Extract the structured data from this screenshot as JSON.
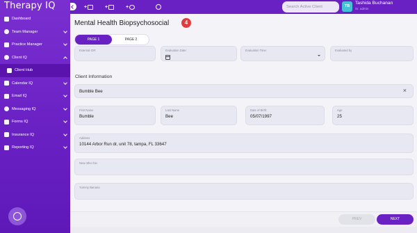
{
  "app": {
    "name": "Therapy IQ"
  },
  "sidebar": {
    "items": [
      {
        "label": "Dashboard",
        "icon": "grid-icon"
      },
      {
        "label": "Team Manager",
        "icon": "team-icon"
      },
      {
        "label": "Practice Manager",
        "icon": "briefcase-icon"
      },
      {
        "label": "Client IQ",
        "icon": "people-icon"
      },
      {
        "label": "Client Hub",
        "icon": "hub-icon"
      },
      {
        "label": "Calendar IQ",
        "icon": "calendar-icon"
      },
      {
        "label": "Email IQ",
        "icon": "email-icon"
      },
      {
        "label": "Messaging IQ",
        "icon": "chat-icon"
      },
      {
        "label": "Forms IQ",
        "icon": "forms-icon"
      },
      {
        "label": "Insurance IQ",
        "icon": "insurance-icon"
      },
      {
        "label": "Reporting IQ",
        "icon": "reporting-icon"
      }
    ]
  },
  "topbar": {
    "search_placeholder": "Search Active Client",
    "user_initials": "TB",
    "user_name": "Tashida Buchanan",
    "user_role": "Sr. admin"
  },
  "page": {
    "title": "Mental Health Biopsychosocial",
    "step_badge": "4",
    "tabs": [
      "PAGE 1",
      "PAGE 2"
    ]
  },
  "form": {
    "external_id_label": "External ID#:",
    "eval_date_label": "Evaluation Date:",
    "eval_time_label": "Evaluation Time:",
    "evaluated_by_label": "Evaluated by",
    "section_title": "Client Information",
    "client_select": "Bumble Bee",
    "first_name_label": "First Name",
    "first_name": "Bumble",
    "last_name_label": "Last Name",
    "last_name": "Bee",
    "dob_label": "Date of Birth:",
    "dob": "05/07/1997",
    "age_label": "Age",
    "age": "25",
    "address_label": "Address",
    "address": "10144 Arbor Run dr, unit 78, tampa, FL 33647",
    "other_bio_label": "New other bio",
    "yummy_label": "Yummy Banana"
  },
  "footer": {
    "prev": "PREV",
    "next": "NEXT"
  },
  "colors": {
    "brand": "#6a21c4",
    "badge": "#e23b3b",
    "avatar": "#44c3d6"
  }
}
